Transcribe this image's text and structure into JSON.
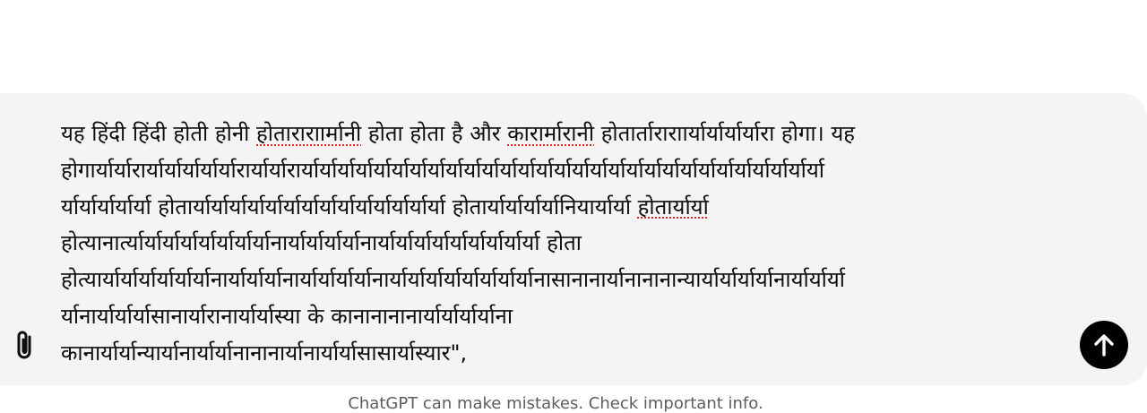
{
  "composer": {
    "lines": [
      {
        "parts": [
          {
            "text": "यह हिंदी हिंदी होती होनी ",
            "spell": false
          },
          {
            "text": "होताराराार्मानी",
            "spell": true
          },
          {
            "text": " होता होता है और ",
            "spell": false
          },
          {
            "text": "कारार्मारानी",
            "spell": true
          },
          {
            "text": " होतार्ताराराार्यार्यार्यार्यारा होगा। यह",
            "spell": false
          }
        ]
      },
      {
        "parts": [
          {
            "text": "होगार्यार्यारार्यार्यार्यार्यार्यारार्यार्यारार्यार्यार्यार्यार्यार्यार्यार्यार्यार्यार्यार्यार्यार्यार्यार्यार्यार्यार्यार्यार्यार्यार्यार्यार्यार्यार्यार्यार्या",
            "spell": false
          }
        ]
      },
      {
        "parts": [
          {
            "text": "र्यार्यार्यार्यार्या होतार्यार्यार्यार्यार्यार्यार्यार्यार्यार्यार्यार्यार्यार्या होतार्यार्यार्यार्यानियार्यार्या ",
            "spell": false
          },
          {
            "text": "होतार्यार्या",
            "spell": true
          }
        ]
      },
      {
        "parts": [
          {
            "text": "होत्यानार्त्यार्यार्यार्यार्यार्यार्यार्यानार्यार्यार्यार्यानार्यार्यार्यार्यार्यार्यार्यार्यार्या होता",
            "spell": false
          }
        ]
      },
      {
        "parts": [
          {
            "text": "होत्यार्यार्यार्यार्यार्यार्यानार्यार्यार्यानार्यार्यार्यार्यानार्यार्यार्यार्यार्यार्यार्यार्यानासानानार्यानानानान्यार्यार्यार्यार्यानार्यार्यार्या",
            "spell": false
          }
        ]
      },
      {
        "parts": [
          {
            "text": "र्यानार्यार्यार्यासानार्यारानार्यार्यास्या के कानानानानार्यार्यार्यार्याना",
            "spell": false
          }
        ]
      },
      {
        "parts": [
          {
            "text": "कानार्यार्यान्यार्यानार्यार्यानानानार्यानार्यार्यासासार्यास्यार\",",
            "spell": false
          }
        ]
      }
    ]
  },
  "attach": {
    "icon": "paperclip-icon"
  },
  "send": {
    "icon": "arrow-up-icon",
    "bg": "#000000",
    "fg": "#ffffff"
  },
  "footer": {
    "note": "ChatGPT can make mistakes. Check important info."
  }
}
